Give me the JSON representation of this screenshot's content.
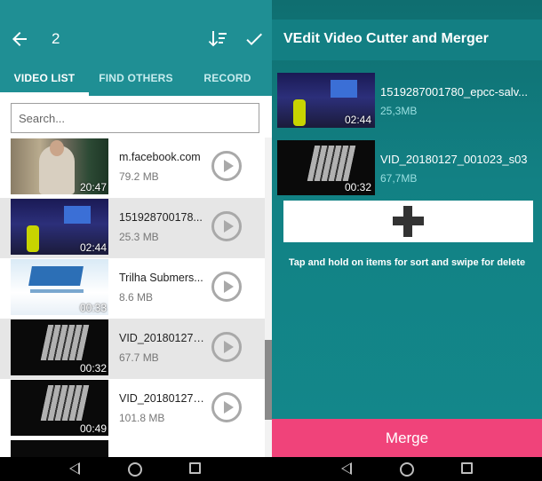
{
  "left": {
    "toolbar": {
      "selected_count": "2"
    },
    "tabs": [
      {
        "label": "VIDEO LIST",
        "active": true
      },
      {
        "label": "FIND OTHERS",
        "active": false
      },
      {
        "label": "RECORD",
        "active": false
      }
    ],
    "search": {
      "placeholder": "Search..."
    },
    "items": [
      {
        "name": "m.facebook.com",
        "size": "79.2 MB",
        "duration": "20:47",
        "selected": false
      },
      {
        "name": "151928700178...",
        "size": "25.3 MB",
        "duration": "02:44",
        "selected": true
      },
      {
        "name": "Trilha Submers...",
        "size": "8.6 MB",
        "duration": "00:33",
        "selected": false
      },
      {
        "name": "VID_20180127_...",
        "size": "67.7 MB",
        "duration": "00:32",
        "selected": true
      },
      {
        "name": "VID_20180127_...",
        "size": "101.8 MB",
        "duration": "00:49",
        "selected": false
      }
    ]
  },
  "right": {
    "title": "VEdit Video Cutter and Merger",
    "items": [
      {
        "name": "1519287001780_epcc-salv...",
        "size": "25,3MB",
        "duration": "02:44"
      },
      {
        "name": "VID_20180127_001023_s03",
        "size": "67,7MB",
        "duration": "00:32"
      }
    ],
    "hint": "Tap and hold on items for sort and swipe for delete",
    "merge_label": "Merge"
  },
  "colors": {
    "header_teal": "#1f8f94",
    "merge_pink": "#f0437a",
    "selected_row": "#e6e6e6"
  }
}
